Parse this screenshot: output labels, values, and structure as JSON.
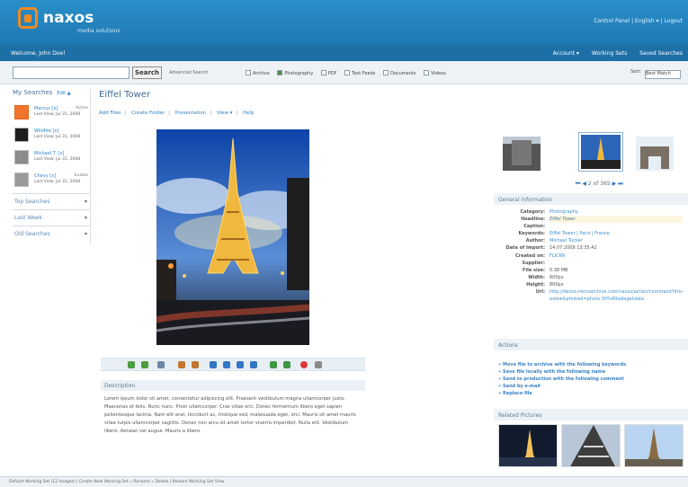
{
  "header": {
    "brand": "naxos",
    "brand_sub": "media solutions",
    "top_links": "Control Panel | English ▾ | Logout"
  },
  "userbar": {
    "welcome": "Welcome, John Doe!",
    "account": "Account ▾",
    "working_sets": "Working Sets",
    "saved_searches": "Saved Searches"
  },
  "search": {
    "button": "Search",
    "advanced": "Advanced Search",
    "filters": [
      "Archive",
      "Photography",
      "PDF",
      "Text Feeds",
      "Documents",
      "Videos"
    ],
    "sort_label": "Sort:",
    "sort_value": "Best Match"
  },
  "sidebar": {
    "title": "My Searches",
    "edit": "Edit ▲",
    "items": [
      {
        "name": "Marcus [x]",
        "meta": "Last View: Jul 31, 2008",
        "status": "Active"
      },
      {
        "name": "Wildfire [x]",
        "meta": "Last View: Jul 31, 2008",
        "status": ""
      },
      {
        "name": "Michael T. [x]",
        "meta": "Last View: Jul 31, 2008",
        "status": ""
      },
      {
        "name": "Chevy [x]",
        "meta": "Last View: Jul 31, 2008",
        "status": "Enable"
      }
    ],
    "sections": [
      "Top Searches",
      "Last Week",
      "Old Searches"
    ]
  },
  "content": {
    "title": "Eiffel Tower",
    "actions": [
      "Add Files",
      "Create Folder",
      "Presentation",
      "View ▾",
      "Help"
    ],
    "description_title": "Description",
    "description": "Lorem ipsum dolor sit amet, consectetur adipiscing elit. Praesent vestibulum magna ullamcorper justo. Maecenas et felis. Nunc nunc. Proin ullamcorper. Cras vitae orci. Donec fermentum libero eget sapien pellentesque lacinia. Nam elit erat, tincidunt ac, tristique sed, malesuada eget, orci. Mauris sit amet mauris vitae turpis ullamcorper sagittis. Donec non arcu sit amet tortor viverra imperdiet. Nulla elit. Vestibulum libero. Aenean vel augue. Mauris a libero."
  },
  "right": {
    "pager": "2 of 365",
    "general_information": "General Information",
    "info": [
      {
        "label": "Category:",
        "value": "Photography"
      },
      {
        "label": "Headline:",
        "value": "Eiffel Tower"
      },
      {
        "label": "Caption:",
        "value": ""
      },
      {
        "label": "Keywords:",
        "value": "Eiffel Tower | Paris | France"
      },
      {
        "label": "Author:",
        "value": "Michael Tucker"
      },
      {
        "label": "Date of Import:",
        "value": "14.07.2008 13:35:42"
      },
      {
        "label": "Created on:",
        "value": "FLICKR"
      },
      {
        "label": "Supplier:",
        "value": ""
      },
      {
        "label": "File size:",
        "value": "0.38 MB"
      },
      {
        "label": "Width:",
        "value": "600px"
      },
      {
        "label": "Height:",
        "value": "800px"
      },
      {
        "label": "Url:",
        "value": "http://demo.microarchive.com/naxos/action/command?driveview&photoid=photo:30%40sidegetdata"
      }
    ],
    "actions_title": "Actions",
    "actions": [
      "» Move file to archive with the following keywords",
      "» Save file locally with the following name",
      "» Send to production with the following comment",
      "» Send by e-mail",
      "» Replace file"
    ],
    "related_title": "Related Pictures"
  },
  "bottombar": {
    "text": "Default Working Set (12 Images)   |   Create New Working Set   » Rename   » Delete   | Restore Working Set View"
  }
}
